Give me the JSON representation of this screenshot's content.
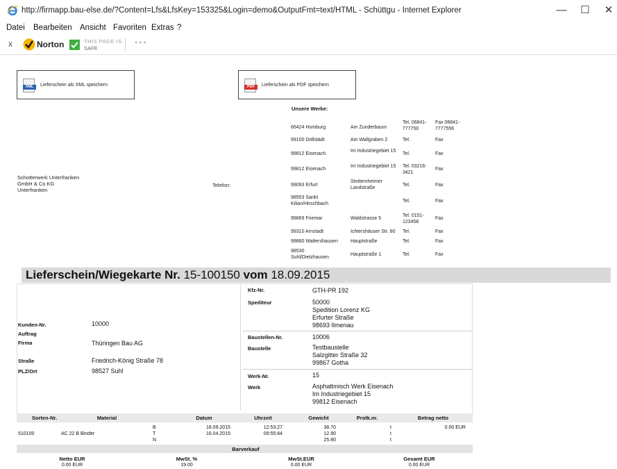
{
  "window": {
    "title": "http://firmapp.bau-else.de/?Content=Lfs&LfsKey=153325&Login=demo&OutputFmt=text/HTML - Schüttgu - Internet Explorer",
    "minimize": "—",
    "maximize": "☐",
    "close": "✕"
  },
  "menu": [
    "Datei",
    "Bearbeiten",
    "Ansicht",
    "Favoriten",
    "Extras",
    "?"
  ],
  "toolbar": {
    "close": "x",
    "norton": "Norton",
    "safe_line1": "THIS PAGE IS",
    "safe_line2": "SAFE",
    "dots": "● ● ●",
    "colors": {
      "norton_check": "#f5b400",
      "safe_check": "#3fae3f"
    }
  },
  "buttons": {
    "xml": "Lieferschein als XML speichern",
    "pdf": "Lieferschein als PDF speichern",
    "xml_icon_text": "XML",
    "pdf_icon_text": "PDF",
    "xml_color": "#2b5fb0",
    "pdf_color": "#d0312d"
  },
  "company": {
    "line1": "Schotterwerk Unterfranken",
    "line2": "GmbH & Co KG",
    "line3": "Unterfranken"
  },
  "telefon_label": "Telefon:",
  "werke": {
    "heading": "Unsere Werke:",
    "rows": [
      {
        "ort": "66424 Homburg",
        "strasse": "Am Zunderbaum",
        "tel": "Tel. 06841-777750",
        "fax": "Fax 06841-7777556"
      },
      {
        "ort": "99100 Döllstädt",
        "strasse": "Am Wallgraben 2",
        "tel": "Tel.",
        "fax": "Fax"
      },
      {
        "ort": "99812 Eisenach",
        "strasse": "Im Industriegebiet 15",
        "tel": "Tel.",
        "fax": "Fax"
      },
      {
        "ort": "99812 Eisenach",
        "strasse": "Im Industriegebiet 15",
        "tel": "Tel. 03216-3421",
        "fax": "Fax"
      },
      {
        "ort": "99093 Erfurt",
        "strasse": "Stotternheimer Landstraße",
        "tel": "Tel.",
        "fax": "Fax"
      },
      {
        "ort": "98553 Sankt Kilian/Hirschbach",
        "strasse": "",
        "tel": "Tel.",
        "fax": "Fax"
      },
      {
        "ort": "99869 Friemar",
        "strasse": "Waldstrasse 5",
        "tel": "Tel. 0151-123456",
        "fax": "Fax"
      },
      {
        "ort": "99310 Arnstadt",
        "strasse": "Ichtershäuser Str. 80",
        "tel": "Tel.",
        "fax": "Fax"
      },
      {
        "ort": "99880 Waltershausen",
        "strasse": "Hauptstraße",
        "tel": "Tel.",
        "fax": "Fax"
      },
      {
        "ort": "98530 Suhl/Dietzhausen",
        "strasse": "Hauptstraße 1",
        "tel": "Tel.",
        "fax": "Fax"
      }
    ]
  },
  "banner": {
    "prefix": "Lieferschein/Wiegekarte Nr.",
    "number": "15-100150",
    "vom": "vom",
    "date": "18.09.2015"
  },
  "left": {
    "kunden_label": "Kunden-Nr.",
    "kunden_value": "10000",
    "auftrag_label": "Auftrag",
    "firma_label": "Firma",
    "firma_value": "Thüringen Bau AG",
    "strasse_label": "Straße",
    "strasse_value": "Friedrich-König Straße 78",
    "plz_label": "PLZ/Ort",
    "plz_value": "98527  Suhl"
  },
  "right": {
    "kfz_label": "Kfz-Nr.",
    "kfz_value": "GTH-PR 192",
    "spediteur_label": "Spediteur",
    "spediteur_lines": [
      "50000",
      "Spedition Lorenz KG",
      "Erfurter Straße",
      "98693  Ilmenau"
    ],
    "baustellen_label": "Baustellen-Nr.",
    "baustellen_value": "10006",
    "baustelle_label": "Baustelle",
    "baustelle_lines": [
      "Testbaustelle",
      "Salzgitter Straße 32",
      "99867  Gotha"
    ],
    "werknr_label": "Werk-Nr.",
    "werknr_value": "15",
    "werk_label": "Werk",
    "werk_lines": [
      "Asphaltmisch Werk Eisenach",
      "Im Industriegebiet 15",
      "99812  Eisenach"
    ]
  },
  "table": {
    "headers": [
      "Sorten-Nr.",
      "Material",
      "Datum",
      "Uhrzeit",
      "Gewicht",
      "Protk.nr.",
      "Betrag netto"
    ],
    "sorte": "510100",
    "material": "AC 22 B Binder",
    "rows": [
      {
        "code": "B",
        "datum": "18.09.2015",
        "uhrzeit": "12:53:27",
        "gewicht": "38.70",
        "unit": "t"
      },
      {
        "code": "T",
        "datum": "16.04.2015",
        "uhrzeit": "09:55:44",
        "gewicht": "12.90",
        "unit": "t"
      },
      {
        "code": "N",
        "datum": "",
        "uhrzeit": "",
        "gewicht": "25.80",
        "unit": "t"
      }
    ],
    "betrag": "0.00 EUR",
    "barverkauf": "Barverkauf",
    "summary_headers": [
      "Netto EUR",
      "MwSt. %",
      "MwSt.EUR",
      "Gesamt EUR"
    ],
    "summary_values": [
      "0.00 EUR",
      "19.00",
      "0.00 EUR",
      "0.00 EUR"
    ]
  }
}
